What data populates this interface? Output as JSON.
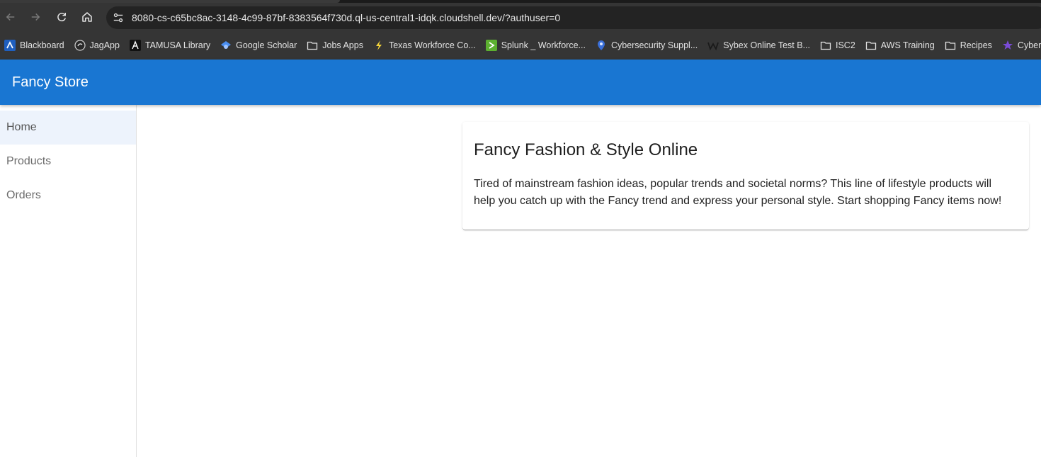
{
  "browser": {
    "url": "8080-cs-c65bc8ac-3148-4c99-87bf-8383564f730d.ql-us-central1-idqk.cloudshell.dev/?authuser=0",
    "bookmarks": [
      {
        "label": "Blackboard",
        "icon": "blackboard-icon"
      },
      {
        "label": "JagApp",
        "icon": "jagapp-icon"
      },
      {
        "label": "TAMUSA Library",
        "icon": "tamusa-library-icon"
      },
      {
        "label": "Google Scholar",
        "icon": "google-scholar-icon"
      },
      {
        "label": "Jobs Apps",
        "icon": "folder-icon"
      },
      {
        "label": "Texas Workforce Co...",
        "icon": "lightning-icon"
      },
      {
        "label": "Splunk _ Workforce...",
        "icon": "splunk-icon"
      },
      {
        "label": "Cybersecurity Suppl...",
        "icon": "location-pin-icon"
      },
      {
        "label": "Sybex Online Test B...",
        "icon": "wiley-icon"
      },
      {
        "label": "ISC2",
        "icon": "folder-icon"
      },
      {
        "label": "AWS Training",
        "icon": "folder-icon"
      },
      {
        "label": "Recipes",
        "icon": "folder-icon"
      },
      {
        "label": "Cyber Sec",
        "icon": "star-icon"
      }
    ]
  },
  "app": {
    "title": "Fancy Store",
    "accent_color": "#1976d2"
  },
  "sidenav": {
    "items": [
      {
        "label": "Home",
        "active": true
      },
      {
        "label": "Products",
        "active": false
      },
      {
        "label": "Orders",
        "active": false
      }
    ]
  },
  "card": {
    "title": "Fancy Fashion & Style Online",
    "text_line_1": "Tired of mainstream fashion ideas, popular trends and societal norms? This line of lifestyle products will",
    "text_line_2": "help you catch up with the Fancy trend and express your personal style. Start shopping Fancy items now!"
  }
}
